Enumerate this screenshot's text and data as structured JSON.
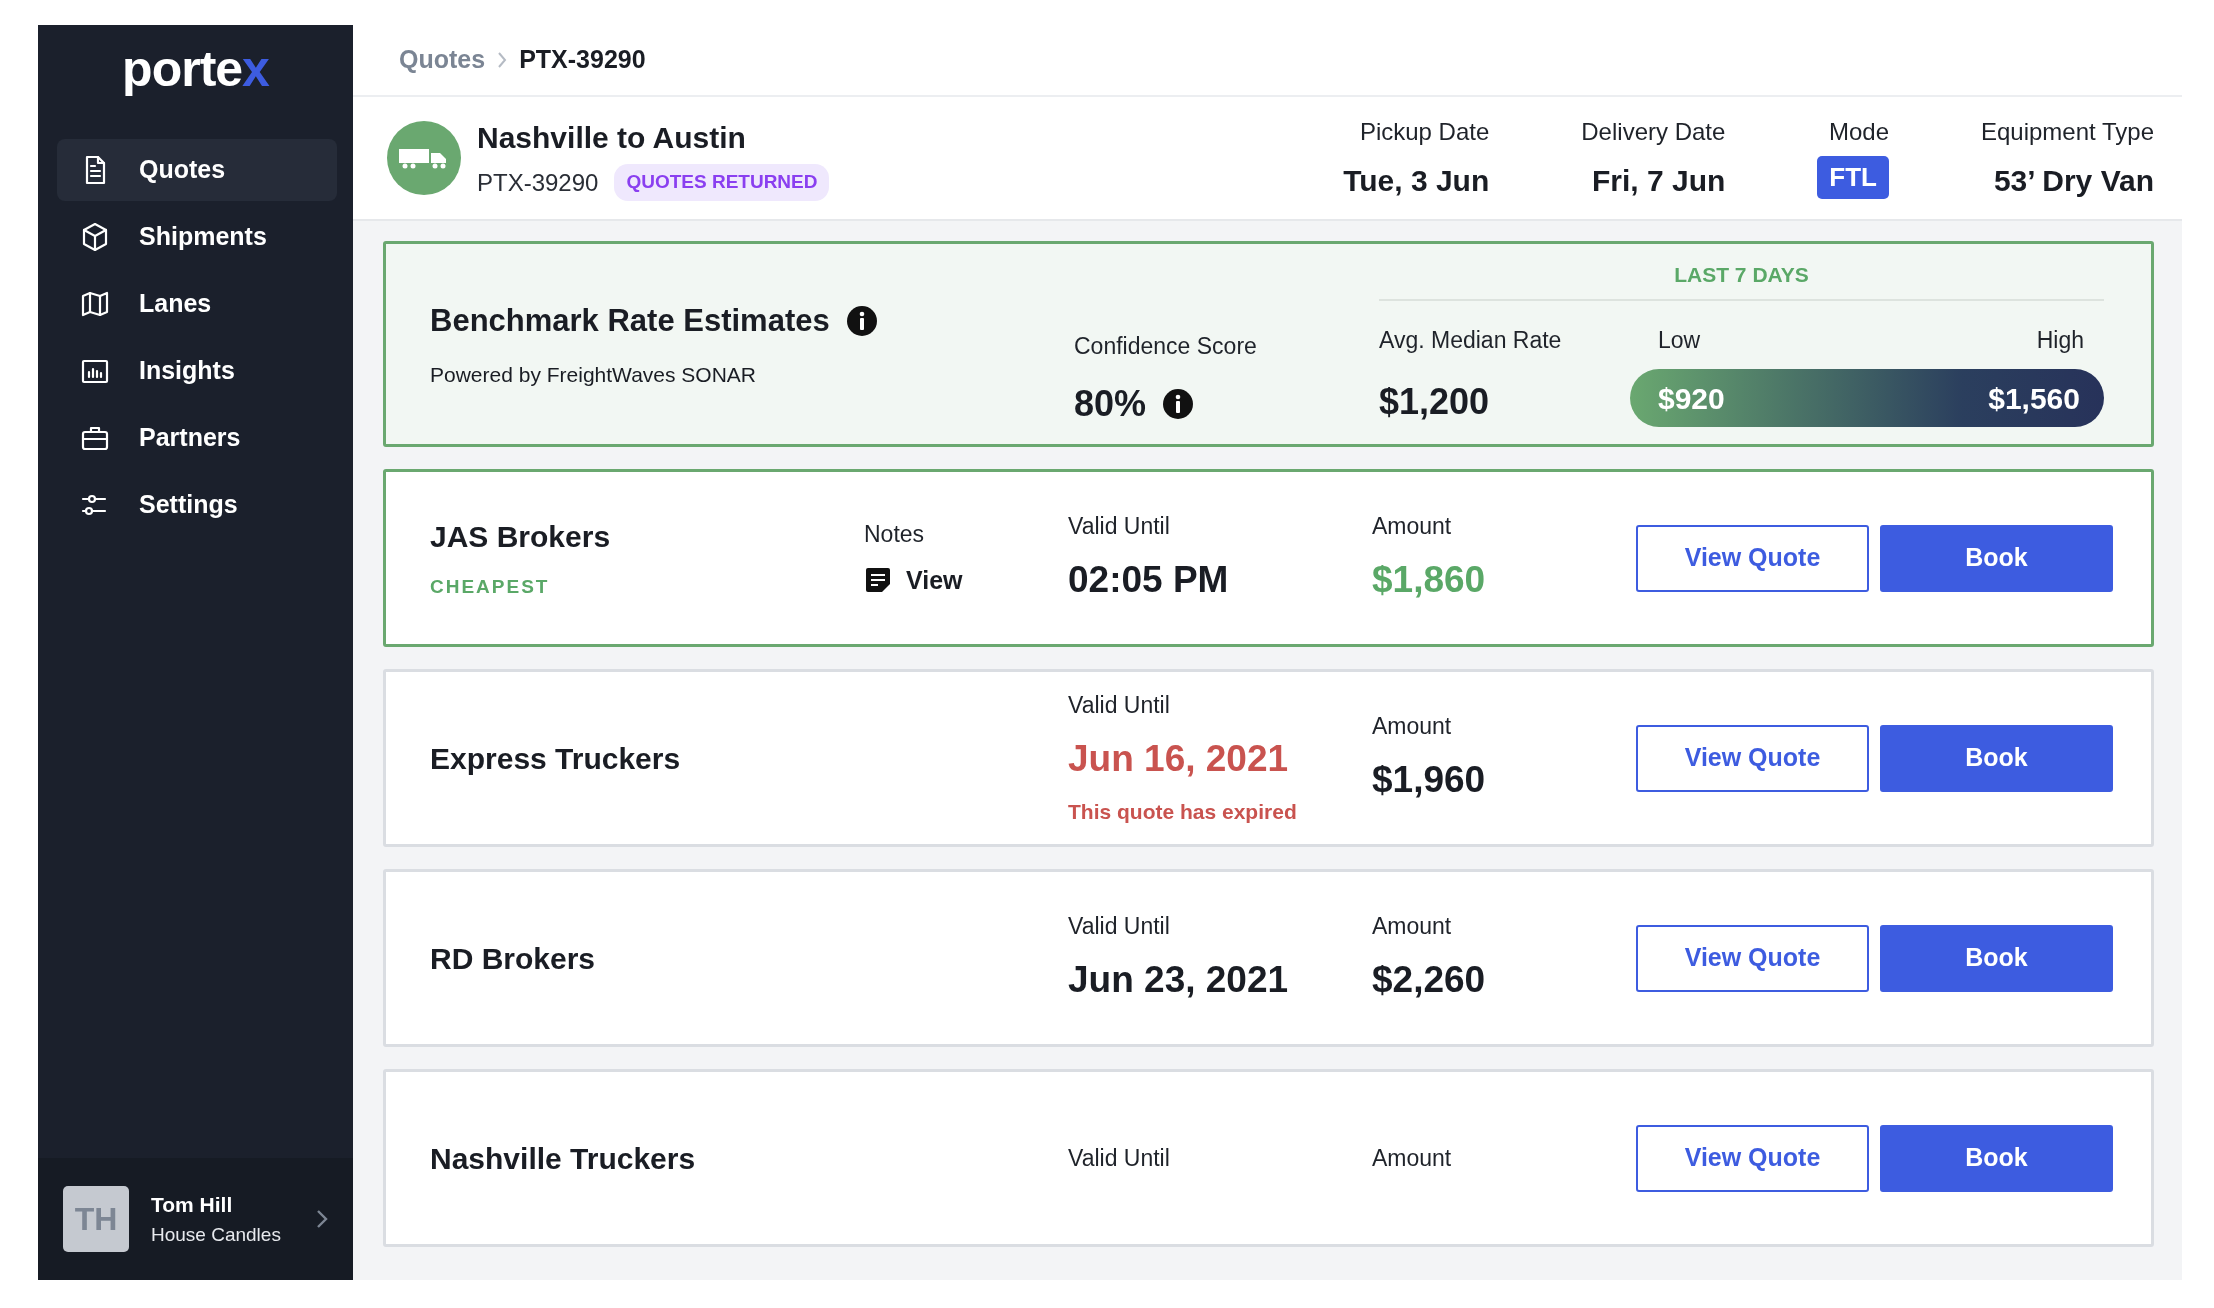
{
  "logo": {
    "main": "porte",
    "accent": "x"
  },
  "nav": [
    {
      "label": "Quotes",
      "kind": "document",
      "selected": true
    },
    {
      "label": "Shipments",
      "kind": "cube",
      "selected": false
    },
    {
      "label": "Lanes",
      "kind": "map",
      "selected": false
    },
    {
      "label": "Insights",
      "kind": "chart",
      "selected": false
    },
    {
      "label": "Partners",
      "kind": "briefcase",
      "selected": false
    },
    {
      "label": "Settings",
      "kind": "sliders",
      "selected": false
    }
  ],
  "user": {
    "initials": "TH",
    "name": "Tom Hill",
    "company": "House Candles"
  },
  "breadcrumb": [
    {
      "label": "Quotes",
      "current": false
    },
    {
      "label": "PTX-39290",
      "current": true
    }
  ],
  "shipment": {
    "title": "Nashville to Austin",
    "id": "PTX-39290",
    "status": "QUOTES RETURNED",
    "details": [
      {
        "label": "Pickup Date",
        "value": "Tue, 3 Jun",
        "kind": "text"
      },
      {
        "label": "Delivery Date",
        "value": "Fri, 7 Jun",
        "kind": "text"
      },
      {
        "label": "Mode",
        "value": "FTL",
        "kind": "badge"
      },
      {
        "label": "Equipment Type",
        "value": "53’ Dry Van",
        "kind": "text"
      }
    ]
  },
  "benchmark": {
    "title": "Benchmark Rate Estimates",
    "subtitle": "Powered by FreightWaves SONAR",
    "confidence_label": "Confidence Score",
    "confidence": "80%",
    "period": "LAST 7 DAYS",
    "median_label": "Avg. Median Rate",
    "median": "$1,200",
    "low_label": "Low",
    "high_label": "High",
    "low": "$920",
    "high": "$1,560"
  },
  "quotes": [
    {
      "carrier": "JAS Brokers",
      "tag": "CHEAPEST",
      "highlighted": true,
      "notes_label": "Notes",
      "notes_link": "View",
      "valid_label": "Valid Until",
      "valid_until": "02:05 PM",
      "expired": false,
      "amount_label": "Amount",
      "amount": "$1,860",
      "buttons": [
        "View Quote",
        "Book"
      ]
    },
    {
      "carrier": "Express Truckers",
      "highlighted": false,
      "valid_label": "Valid Until",
      "valid_until": "Jun 16, 2021",
      "expired": true,
      "expired_note": "This quote has expired",
      "amount_label": "Amount",
      "amount": "$1,960",
      "buttons": [
        "View Quote",
        "Book"
      ]
    },
    {
      "carrier": "RD Brokers",
      "highlighted": false,
      "valid_label": "Valid Until",
      "valid_until": "Jun 23, 2021",
      "expired": false,
      "amount_label": "Amount",
      "amount": "$2,260",
      "buttons": [
        "View Quote",
        "Book"
      ]
    },
    {
      "carrier": "Nashville Truckers",
      "highlighted": false,
      "valid_label": "Valid Until",
      "expired": false,
      "amount_label": "Amount",
      "buttons": [
        "View Quote",
        "Book"
      ]
    }
  ]
}
